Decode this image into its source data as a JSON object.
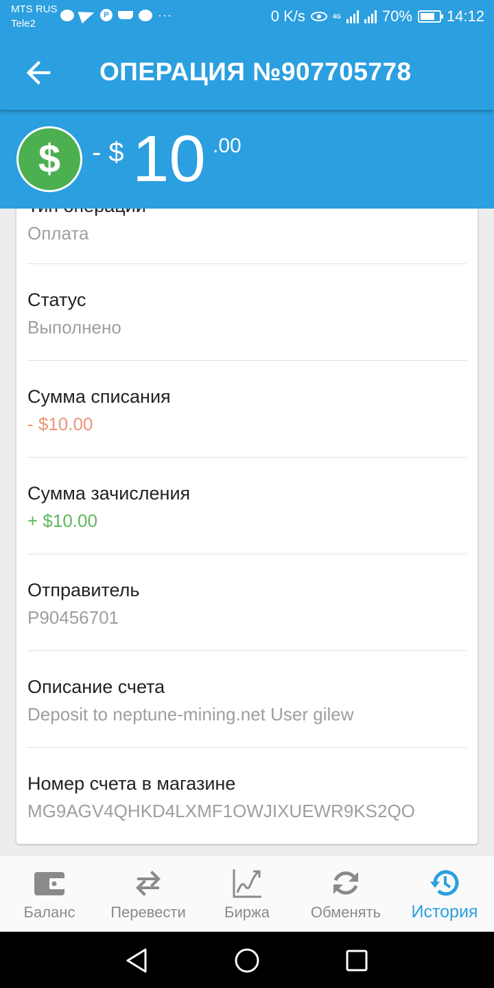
{
  "status_bar": {
    "carrier_1": "MTS RUS",
    "carrier_2": "Tele2",
    "net_speed": "0 K/s",
    "network_type": "4G",
    "battery": "70%",
    "time": "14:12"
  },
  "header": {
    "title": "ОПЕРАЦИЯ №907705778",
    "icon": "back-arrow"
  },
  "amount": {
    "icon": "dollar-sign",
    "sign": "- $",
    "main": "10",
    "cents": ".00",
    "color": "#4caf50"
  },
  "details": {
    "items": [
      {
        "label": "Тип операции",
        "value": "Оплата"
      },
      {
        "label": "Статус",
        "value": "Выполнено"
      },
      {
        "label": "Сумма списания",
        "value": "- $10.00"
      },
      {
        "label": "Сумма зачисления",
        "value": "+ $10.00"
      },
      {
        "label": "Отправитель",
        "value": "P90456701"
      },
      {
        "label": "Описание счета",
        "value": "Deposit to neptune-mining.net User gilew"
      },
      {
        "label": "Номер счета в магазине",
        "value": "MG9AGV4QHKD4LXMF1OWJIXUEWR9KS2QO"
      }
    ]
  },
  "bottom_nav": {
    "items": [
      {
        "label": "Баланс",
        "icon": "wallet-icon"
      },
      {
        "label": "Перевести",
        "icon": "transfer-arrows-icon"
      },
      {
        "label": "Биржа",
        "icon": "chart-icon"
      },
      {
        "label": "Обменять",
        "icon": "exchange-icon"
      },
      {
        "label": "История",
        "icon": "history-icon",
        "active": true
      }
    ]
  },
  "colors": {
    "primary": "#2b9fdf",
    "debit": "#e8957a",
    "credit": "#5cb85c",
    "secondary_text": "#9e9e9e"
  }
}
